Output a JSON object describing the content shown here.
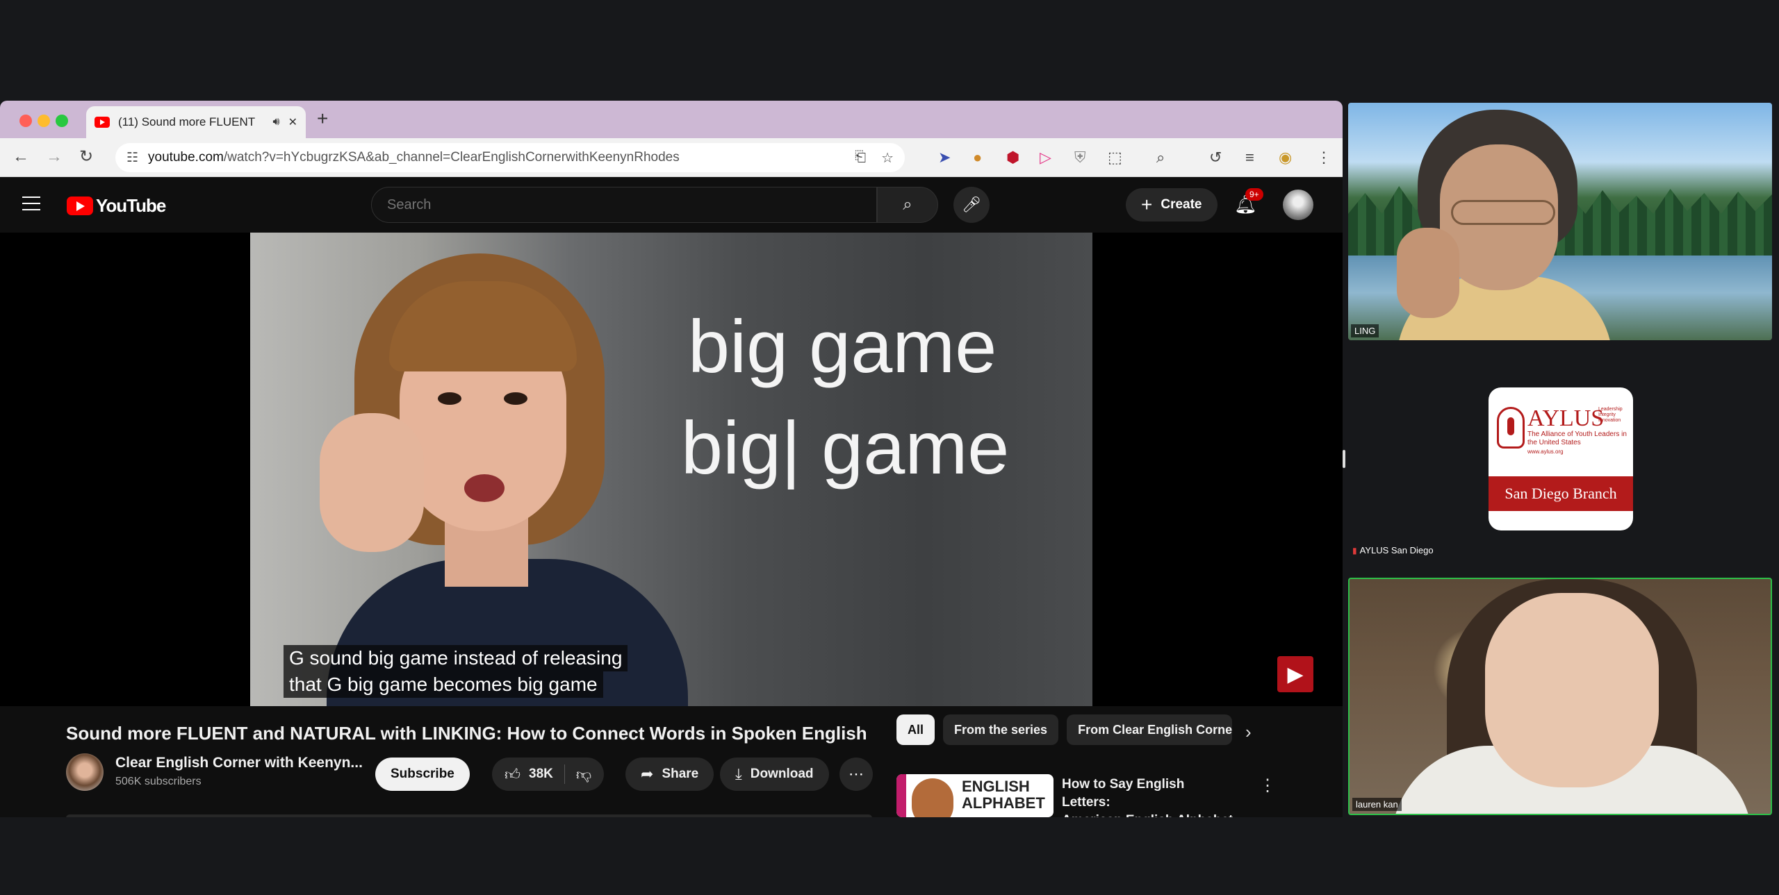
{
  "browser": {
    "tab_title": "(11) Sound more FLUENT",
    "url_host": "youtube.com",
    "url_path": "/watch?v=hYcbugrzKSA&ab_channel=ClearEnglishCornerwithKeenynRhodes"
  },
  "youtube": {
    "logo_text": "YouTube",
    "search_placeholder": "Search",
    "create_label": "Create",
    "notification_badge": "9+",
    "video_overlay_line1": "big game",
    "video_overlay_line2": "big| game",
    "caption_line1": "G sound big game instead of releasing",
    "caption_line2": "that G big game becomes big game",
    "video_title": "Sound more FLUENT and NATURAL with LINKING: How to Connect Words in Spoken English",
    "channel_name": "Clear English Corner with Keenyn...",
    "subscribers": "506K subscribers",
    "subscribe_label": "Subscribe",
    "like_count": "38K",
    "share_label": "Share",
    "download_label": "Download",
    "chips": [
      "All",
      "From the series",
      "From Clear English Corne"
    ],
    "recommendation": {
      "thumb_text_line1": "ENGLISH",
      "thumb_text_line2": "ALPHABET",
      "title_line1": "How to Say English Letters:",
      "title_line2": "American English Alphabet"
    }
  },
  "meeting": {
    "participant1_name": "LING",
    "aylus_logo_name": "AYLUS",
    "aylus_logo_small": "Leadership Integrity Innovation",
    "aylus_tagline": "The Alliance of Youth Leaders in the United States",
    "aylus_web": "www.aylus.org",
    "aylus_branch": "San Diego Branch",
    "participant2_name": "AYLUS San Diego",
    "participant3_name": "lauren kan"
  },
  "colors": {
    "youtube_red": "#ff0000",
    "active_speaker_border": "#2dbf48",
    "aylus_red": "#b31b1b",
    "tabstrip": "#cdb8d4"
  },
  "icons": [
    "back-icon",
    "forward-icon",
    "reload-icon",
    "site-settings-icon",
    "install-icon",
    "star-icon",
    "speaker-icon",
    "close-icon",
    "search-icon",
    "mic-icon",
    "bell-icon",
    "like-icon",
    "dislike-icon",
    "share-icon",
    "download-icon",
    "more-icon",
    "chevron-right-icon",
    "kebab-icon"
  ]
}
